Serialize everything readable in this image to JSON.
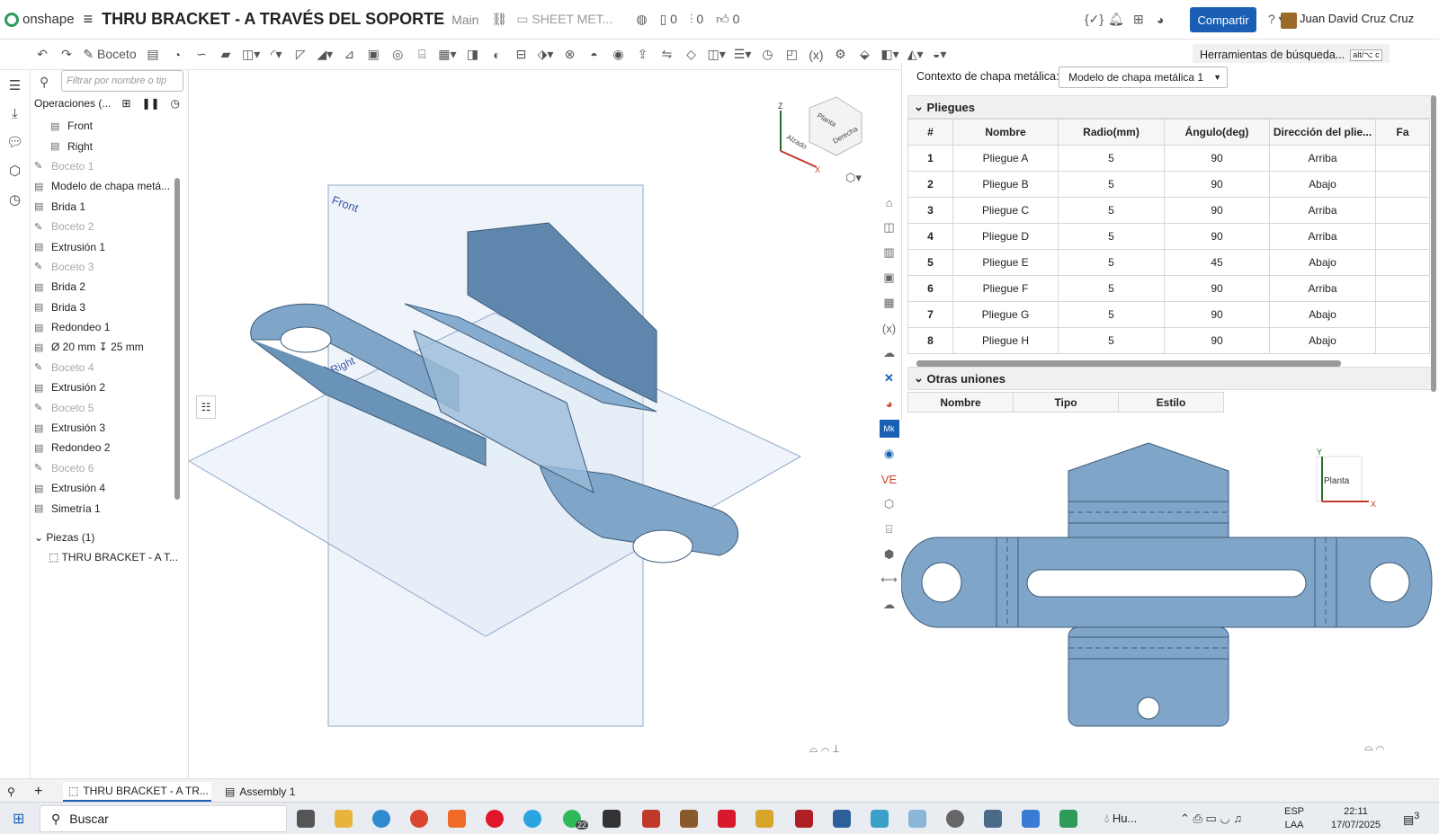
{
  "app": {
    "name": "onshape",
    "doc_title": "THRU BRACKET - A TRAVÉS DEL SOPORTE",
    "branch": "Main",
    "workspace": "SHEET MET...",
    "counts": [
      "0",
      "0",
      "0"
    ],
    "share_label": "Compartir",
    "user": "Juan David Cruz Cruz"
  },
  "toolbar": {
    "sketch_label": "Boceto",
    "search_tools": "Herramientas de búsqueda...",
    "shortcut": "alt/⌥ c"
  },
  "features": {
    "filter_placeholder": "Filtrar por nombre o tip",
    "header": "Operaciones (...",
    "items": [
      {
        "label": "Front",
        "dim": false,
        "indent": true
      },
      {
        "label": "Right",
        "dim": false,
        "indent": true
      },
      {
        "label": "Boceto 1",
        "dim": true
      },
      {
        "label": "Modelo de chapa metá...",
        "dim": false
      },
      {
        "label": "Brida 1",
        "dim": false
      },
      {
        "label": "Boceto 2",
        "dim": true
      },
      {
        "label": "Extrusión 1",
        "dim": false
      },
      {
        "label": "Boceto 3",
        "dim": true
      },
      {
        "label": "Brida 2",
        "dim": false
      },
      {
        "label": "Brida 3",
        "dim": false
      },
      {
        "label": "Redondeo 1",
        "dim": false
      },
      {
        "label": "Ø 20 mm ↧ 25 mm",
        "dim": false
      },
      {
        "label": "Boceto 4",
        "dim": true
      },
      {
        "label": "Extrusión 2",
        "dim": false
      },
      {
        "label": "Boceto 5",
        "dim": true
      },
      {
        "label": "Extrusión 3",
        "dim": false
      },
      {
        "label": "Redondeo 2",
        "dim": false
      },
      {
        "label": "Boceto 6",
        "dim": true
      },
      {
        "label": "Extrusión 4",
        "dim": false
      },
      {
        "label": "Simetría 1",
        "dim": false
      }
    ],
    "parts_header": "Piezas (1)",
    "part": "THRU BRACKET - A T..."
  },
  "viewport": {
    "plane_front": "Front",
    "plane_right": "Right",
    "cube": [
      "Planta",
      "Alzado",
      "Derecha"
    ],
    "axes": [
      "Z",
      "X"
    ]
  },
  "sheetmetal": {
    "context_label": "Contexto de chapa metálica:",
    "context_value": "Modelo de chapa metálica 1",
    "bends_title": "Pliegues",
    "columns": [
      "#",
      "Nombre",
      "Radio(mm)",
      "Ángulo(deg)",
      "Dirección del plie...",
      "Fa"
    ],
    "rows": [
      [
        "1",
        "Pliegue A",
        "5",
        "90",
        "Arriba"
      ],
      [
        "2",
        "Pliegue B",
        "5",
        "90",
        "Abajo"
      ],
      [
        "3",
        "Pliegue C",
        "5",
        "90",
        "Arriba"
      ],
      [
        "4",
        "Pliegue D",
        "5",
        "90",
        "Arriba"
      ],
      [
        "5",
        "Pliegue E",
        "5",
        "45",
        "Abajo"
      ],
      [
        "6",
        "Pliegue F",
        "5",
        "90",
        "Arriba"
      ],
      [
        "7",
        "Pliegue G",
        "5",
        "90",
        "Abajo"
      ],
      [
        "8",
        "Pliegue H",
        "5",
        "90",
        "Abajo"
      ]
    ],
    "joints_title": "Otras uniones",
    "joint_columns": [
      "Nombre",
      "Tipo",
      "Estilo"
    ]
  },
  "flat": {
    "view_label": "Planta",
    "axes": [
      "Y",
      "X"
    ]
  },
  "tabs": [
    "THRU BRACKET - A TR...",
    "Assembly 1"
  ],
  "taskbar": {
    "search": "Buscar",
    "badge": "22",
    "weather": "Hu...",
    "lang": "ESP",
    "lang2": "LAA",
    "time": "22:11",
    "date": "17/07/2025",
    "notif": "3"
  },
  "colors": {
    "accent": "#1b5fb5",
    "part": "#7fa6c9",
    "plane": "#c9d9ec"
  }
}
